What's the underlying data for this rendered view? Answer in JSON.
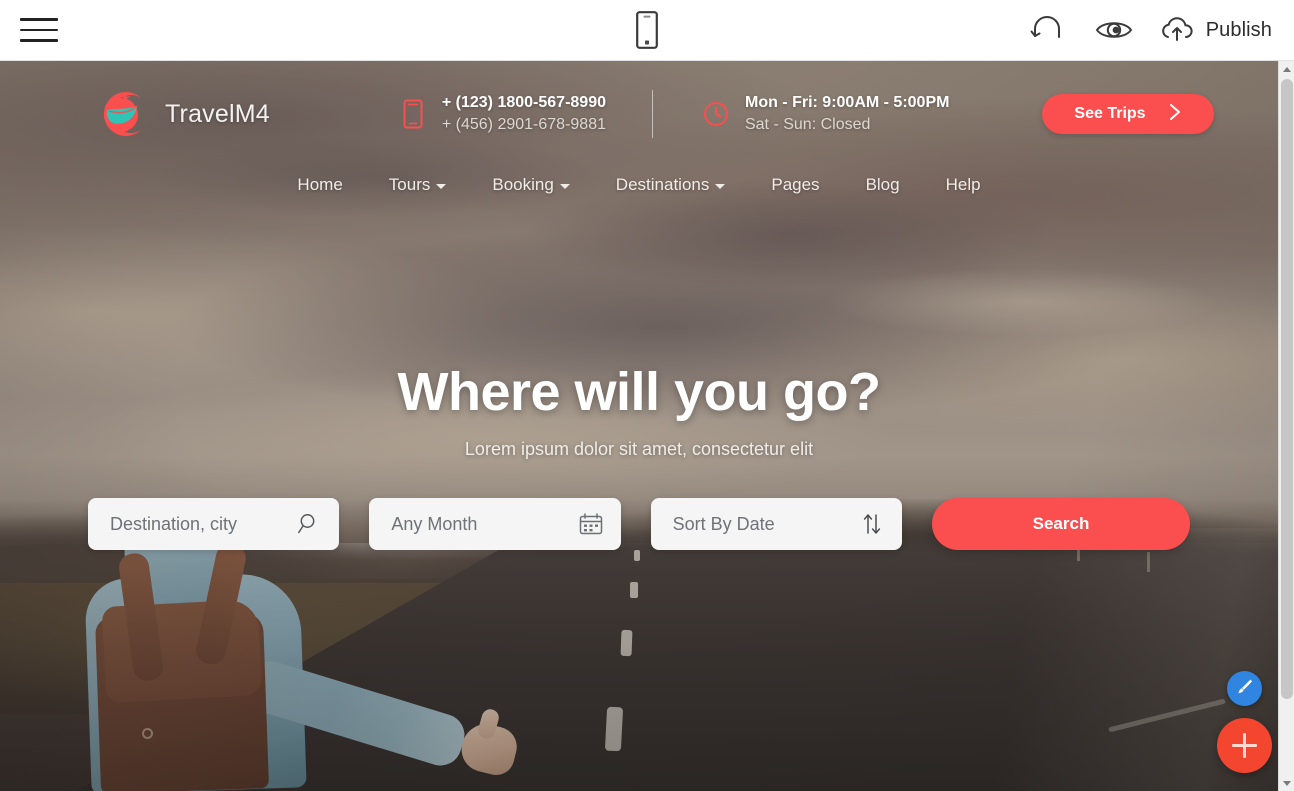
{
  "builder_bar": {
    "menu_icon": "hamburger-icon",
    "device_preview_icon": "mobile-phone-icon",
    "undo_icon": "undo-arrow-icon",
    "preview_icon": "eye-icon",
    "publish_icon": "cloud-upload-icon",
    "publish_label": "Publish"
  },
  "site": {
    "brand": {
      "name": "TravelM4",
      "logo_icon": "travel-leaf-plane-logo"
    },
    "contact": {
      "phone_icon": "mobile-phone-icon",
      "phone_primary": "+ (123) 1800-567-8990",
      "phone_secondary": "+ (456) 2901-678-9881",
      "clock_icon": "clock-icon",
      "hours_primary": "Mon - Fri: 9:00AM - 5:00PM",
      "hours_secondary": "Sat - Sun: Closed"
    },
    "cta": {
      "label": "See Trips",
      "arrow_icon": "chevron-right-icon"
    },
    "nav": [
      {
        "label": "Home",
        "has_dropdown": false
      },
      {
        "label": "Tours",
        "has_dropdown": true
      },
      {
        "label": "Booking",
        "has_dropdown": true
      },
      {
        "label": "Destinations",
        "has_dropdown": true
      },
      {
        "label": "Pages",
        "has_dropdown": false
      },
      {
        "label": "Blog",
        "has_dropdown": false
      },
      {
        "label": "Help",
        "has_dropdown": false
      }
    ]
  },
  "hero": {
    "title": "Where will you go?",
    "subtitle": "Lorem ipsum dolor sit amet, consectetur elit",
    "search": {
      "destination_placeholder": "Destination, city",
      "destination_icon": "magnifier-icon",
      "month_placeholder": "Any Month",
      "month_icon": "calendar-icon",
      "sort_placeholder": "Sort By Date",
      "sort_icon": "sort-updown-icon",
      "button_label": "Search"
    }
  },
  "floating_actions": {
    "style_icon": "paintbrush-icon",
    "add_icon": "plus-icon"
  },
  "colors": {
    "accent_red": "#fb4e4e",
    "fab_add_red": "#f4462f",
    "fab_style_blue": "#2f85e0",
    "logo_teal": "#2ec4b6",
    "logo_red": "#fb4e4e",
    "field_bg": "#f5f5f5",
    "bar_bg": "#ffffff"
  }
}
